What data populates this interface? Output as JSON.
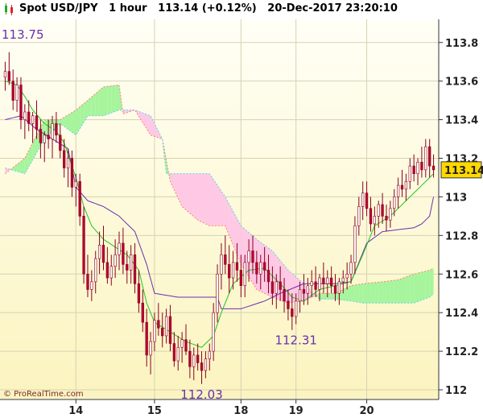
{
  "header": {
    "title": "Spot USD/JPY   1 hour   113.14 (+0.12%)   20-Dec-2017 23:20:10"
  },
  "credit": "© ProRealTime.com",
  "colors": {
    "bg_top": "#fffff6",
    "bg_bottom": "#fbf4bf",
    "candle_up": "#b8002e",
    "candle_down": "#b8002e",
    "kijun": "#6a2fb0",
    "tenkan": "#22c422",
    "cloud_bull": "#a6f59c",
    "cloud_bear": "#ffc8e4",
    "span_a": "#ff8080",
    "span_b": "#60d0f0",
    "price_badge": "#ffd800"
  },
  "chart_data": {
    "type": "candlestick",
    "title": "Spot USD/JPY   1 hour",
    "current_price": "113.14",
    "y_ticks": [
      "113.8",
      "113.6",
      "113.4",
      "113.2",
      "113",
      "112.8",
      "112.6",
      "112.4",
      "112.2",
      "112"
    ],
    "y_tick_values": [
      113.8,
      113.6,
      113.4,
      113.2,
      113.0,
      112.8,
      112.6,
      112.4,
      112.2,
      112.0
    ],
    "ylim": [
      111.95,
      113.92
    ],
    "x_ticks": [
      "14",
      "15",
      "18",
      "19",
      "20"
    ],
    "x_tick_positions": [
      18,
      38,
      60,
      74,
      92
    ],
    "x_count": 110,
    "annotations": [
      {
        "label": "113.75",
        "value": 113.75,
        "index": 0
      },
      {
        "label": "112.03",
        "value": 112.03,
        "index": 50
      },
      {
        "label": "112.31",
        "value": 112.31,
        "index": 74
      }
    ],
    "candles": [
      [
        113.62,
        113.7,
        113.55,
        113.65
      ],
      [
        113.65,
        113.75,
        113.58,
        113.6
      ],
      [
        113.6,
        113.66,
        113.45,
        113.5
      ],
      [
        113.5,
        113.62,
        113.44,
        113.58
      ],
      [
        113.58,
        113.62,
        113.35,
        113.4
      ],
      [
        113.4,
        113.48,
        113.3,
        113.44
      ],
      [
        113.44,
        113.5,
        113.34,
        113.38
      ],
      [
        113.38,
        113.44,
        113.28,
        113.42
      ],
      [
        113.42,
        113.5,
        113.3,
        113.35
      ],
      [
        113.35,
        113.4,
        113.2,
        113.28
      ],
      [
        113.28,
        113.34,
        113.18,
        113.32
      ],
      [
        113.32,
        113.4,
        113.25,
        113.3
      ],
      [
        113.3,
        113.42,
        113.2,
        113.38
      ],
      [
        113.38,
        113.44,
        113.28,
        113.32
      ],
      [
        113.32,
        113.38,
        113.2,
        113.24
      ],
      [
        113.24,
        113.3,
        113.1,
        113.15
      ],
      [
        113.15,
        113.25,
        113.05,
        113.2
      ],
      [
        113.2,
        113.24,
        113.0,
        113.05
      ],
      [
        113.05,
        113.12,
        112.95,
        113.08
      ],
      [
        113.08,
        113.12,
        112.85,
        112.9
      ],
      [
        112.9,
        112.95,
        112.55,
        112.6
      ],
      [
        112.6,
        112.7,
        112.48,
        112.52
      ],
      [
        112.52,
        112.62,
        112.46,
        112.56
      ],
      [
        112.56,
        112.72,
        112.5,
        112.68
      ],
      [
        112.68,
        112.82,
        112.6,
        112.75
      ],
      [
        112.75,
        112.85,
        112.62,
        112.66
      ],
      [
        112.66,
        112.74,
        112.55,
        112.58
      ],
      [
        112.58,
        112.7,
        112.54,
        112.64
      ],
      [
        112.64,
        112.78,
        112.58,
        112.7
      ],
      [
        112.7,
        112.82,
        112.62,
        112.76
      ],
      [
        112.76,
        112.84,
        112.6,
        112.65
      ],
      [
        112.65,
        112.72,
        112.55,
        112.62
      ],
      [
        112.62,
        112.75,
        112.55,
        112.7
      ],
      [
        112.7,
        112.76,
        112.5,
        112.55
      ],
      [
        112.55,
        112.62,
        112.4,
        112.45
      ],
      [
        112.45,
        112.52,
        112.3,
        112.35
      ],
      [
        112.35,
        112.42,
        112.12,
        112.18
      ],
      [
        112.18,
        112.3,
        112.08,
        112.25
      ],
      [
        112.25,
        112.4,
        112.2,
        112.36
      ],
      [
        112.36,
        112.45,
        112.28,
        112.32
      ],
      [
        112.32,
        112.4,
        112.22,
        112.28
      ],
      [
        112.28,
        112.42,
        112.24,
        112.38
      ],
      [
        112.38,
        112.44,
        112.2,
        112.24
      ],
      [
        112.24,
        112.3,
        112.12,
        112.15
      ],
      [
        112.15,
        112.28,
        112.1,
        112.22
      ],
      [
        112.22,
        112.3,
        112.14,
        112.26
      ],
      [
        112.26,
        112.34,
        112.18,
        112.2
      ],
      [
        112.2,
        112.26,
        112.06,
        112.12
      ],
      [
        112.12,
        112.22,
        112.05,
        112.18
      ],
      [
        112.18,
        112.24,
        112.1,
        112.14
      ],
      [
        112.14,
        112.2,
        112.03,
        112.1
      ],
      [
        112.1,
        112.2,
        112.06,
        112.16
      ],
      [
        112.16,
        112.24,
        112.1,
        112.2
      ],
      [
        112.2,
        112.45,
        112.15,
        112.4
      ],
      [
        112.4,
        112.65,
        112.35,
        112.6
      ],
      [
        112.6,
        112.76,
        112.52,
        112.7
      ],
      [
        112.7,
        112.8,
        112.6,
        112.65
      ],
      [
        112.65,
        112.75,
        112.5,
        112.58
      ],
      [
        112.58,
        112.72,
        112.52,
        112.66
      ],
      [
        112.66,
        112.76,
        112.56,
        112.62
      ],
      [
        112.62,
        112.7,
        112.48,
        112.54
      ],
      [
        112.54,
        112.7,
        112.48,
        112.66
      ],
      [
        112.66,
        112.78,
        112.56,
        112.72
      ],
      [
        112.72,
        112.8,
        112.6,
        112.66
      ],
      [
        112.66,
        112.72,
        112.55,
        112.6
      ],
      [
        112.6,
        112.7,
        112.52,
        112.66
      ],
      [
        112.66,
        112.74,
        112.56,
        112.62
      ],
      [
        112.62,
        112.7,
        112.5,
        112.56
      ],
      [
        112.56,
        112.64,
        112.44,
        112.5
      ],
      [
        112.5,
        112.6,
        112.42,
        112.56
      ],
      [
        112.56,
        112.64,
        112.46,
        112.52
      ],
      [
        112.52,
        112.58,
        112.4,
        112.46
      ],
      [
        112.46,
        112.52,
        112.36,
        112.42
      ],
      [
        112.42,
        112.5,
        112.31,
        112.38
      ],
      [
        112.38,
        112.5,
        112.34,
        112.46
      ],
      [
        112.46,
        112.56,
        112.4,
        112.52
      ],
      [
        112.52,
        112.6,
        112.44,
        112.5
      ],
      [
        112.5,
        112.58,
        112.44,
        112.54
      ],
      [
        112.54,
        112.62,
        112.48,
        112.56
      ],
      [
        112.56,
        112.64,
        112.48,
        112.52
      ],
      [
        112.52,
        112.6,
        112.46,
        112.58
      ],
      [
        112.58,
        112.66,
        112.5,
        112.55
      ],
      [
        112.55,
        112.62,
        112.48,
        112.58
      ],
      [
        112.58,
        112.64,
        112.5,
        112.54
      ],
      [
        112.54,
        112.6,
        112.46,
        112.5
      ],
      [
        112.5,
        112.58,
        112.44,
        112.56
      ],
      [
        112.56,
        112.62,
        112.5,
        112.58
      ],
      [
        112.58,
        112.66,
        112.52,
        112.6
      ],
      [
        112.6,
        112.7,
        112.55,
        112.66
      ],
      [
        112.66,
        112.9,
        112.6,
        112.85
      ],
      [
        112.85,
        113.0,
        112.8,
        112.95
      ],
      [
        112.95,
        113.08,
        112.88,
        113.02
      ],
      [
        113.02,
        113.08,
        112.9,
        112.94
      ],
      [
        112.94,
        113.0,
        112.82,
        112.86
      ],
      [
        112.86,
        112.95,
        112.8,
        112.9
      ],
      [
        112.9,
        112.98,
        112.84,
        112.96
      ],
      [
        112.96,
        113.02,
        112.86,
        112.9
      ],
      [
        112.9,
        112.96,
        112.82,
        112.88
      ],
      [
        112.88,
        112.98,
        112.84,
        112.94
      ],
      [
        112.94,
        113.04,
        112.9,
        113.0
      ],
      [
        113.0,
        113.1,
        112.94,
        113.06
      ],
      [
        113.06,
        113.14,
        113.0,
        113.04
      ],
      [
        113.04,
        113.12,
        112.98,
        113.08
      ],
      [
        113.08,
        113.2,
        113.04,
        113.16
      ],
      [
        113.16,
        113.22,
        113.08,
        113.12
      ],
      [
        113.12,
        113.2,
        113.06,
        113.18
      ],
      [
        113.18,
        113.26,
        113.1,
        113.14
      ],
      [
        113.14,
        113.3,
        113.1,
        113.26
      ],
      [
        113.26,
        113.3,
        113.1,
        113.16
      ],
      [
        113.16,
        113.22,
        113.1,
        113.14
      ]
    ],
    "tenkan": [
      [
        0,
        113.6
      ],
      [
        3,
        113.58
      ],
      [
        5,
        113.52
      ],
      [
        7,
        113.45
      ],
      [
        10,
        113.38
      ],
      [
        13,
        113.34
      ],
      [
        15,
        113.28
      ],
      [
        18,
        113.1
      ],
      [
        20,
        112.95
      ],
      [
        22,
        112.85
      ],
      [
        25,
        112.78
      ],
      [
        28,
        112.74
      ],
      [
        31,
        112.7
      ],
      [
        34,
        112.62
      ],
      [
        36,
        112.45
      ],
      [
        38,
        112.35
      ],
      [
        42,
        112.3
      ],
      [
        46,
        112.25
      ],
      [
        50,
        112.22
      ],
      [
        53,
        112.28
      ],
      [
        55,
        112.4
      ],
      [
        58,
        112.55
      ],
      [
        62,
        112.62
      ],
      [
        66,
        112.63
      ],
      [
        70,
        112.55
      ],
      [
        73,
        112.48
      ],
      [
        76,
        112.46
      ],
      [
        80,
        112.52
      ],
      [
        84,
        112.54
      ],
      [
        88,
        112.56
      ],
      [
        91,
        112.7
      ],
      [
        94,
        112.85
      ],
      [
        98,
        112.9
      ],
      [
        102,
        112.98
      ],
      [
        106,
        113.06
      ],
      [
        109,
        113.12
      ]
    ],
    "kijun": [
      [
        0,
        113.4
      ],
      [
        4,
        113.42
      ],
      [
        8,
        113.35
      ],
      [
        12,
        113.3
      ],
      [
        16,
        113.25
      ],
      [
        18,
        113.05
      ],
      [
        21,
        112.98
      ],
      [
        25,
        112.95
      ],
      [
        29,
        112.9
      ],
      [
        33,
        112.82
      ],
      [
        36,
        112.65
      ],
      [
        38,
        112.5
      ],
      [
        44,
        112.48
      ],
      [
        50,
        112.48
      ],
      [
        54,
        112.48
      ],
      [
        55,
        112.42
      ],
      [
        60,
        112.42
      ],
      [
        66,
        112.46
      ],
      [
        70,
        112.5
      ],
      [
        76,
        112.55
      ],
      [
        84,
        112.55
      ],
      [
        88,
        112.56
      ],
      [
        92,
        112.76
      ],
      [
        96,
        112.82
      ],
      [
        104,
        112.84
      ],
      [
        106,
        112.86
      ],
      [
        108,
        112.9
      ],
      [
        109,
        113.0
      ]
    ],
    "span_a": [
      [
        0,
        113.12
      ],
      [
        5,
        113.2
      ],
      [
        10,
        113.4
      ],
      [
        14,
        113.4
      ],
      [
        18,
        113.45
      ],
      [
        21,
        113.5
      ],
      [
        25,
        113.57
      ],
      [
        29,
        113.58
      ],
      [
        30,
        113.43
      ],
      [
        33,
        113.45
      ],
      [
        37,
        113.32
      ],
      [
        40,
        113.3
      ],
      [
        42,
        113.08
      ],
      [
        45,
        112.95
      ],
      [
        49,
        112.88
      ],
      [
        52,
        112.85
      ],
      [
        56,
        112.85
      ],
      [
        60,
        112.65
      ],
      [
        64,
        112.52
      ],
      [
        68,
        112.48
      ],
      [
        72,
        112.45
      ],
      [
        76,
        112.46
      ],
      [
        80,
        112.5
      ],
      [
        84,
        112.5
      ],
      [
        88,
        112.54
      ],
      [
        91,
        112.55
      ],
      [
        96,
        112.56
      ],
      [
        100,
        112.57
      ],
      [
        104,
        112.6
      ],
      [
        108,
        112.62
      ],
      [
        109,
        112.63
      ]
    ],
    "span_b": [
      [
        0,
        113.15
      ],
      [
        5,
        113.12
      ],
      [
        10,
        113.3
      ],
      [
        14,
        113.38
      ],
      [
        18,
        113.32
      ],
      [
        21,
        113.42
      ],
      [
        25,
        113.42
      ],
      [
        29,
        113.45
      ],
      [
        30,
        113.45
      ],
      [
        33,
        113.45
      ],
      [
        37,
        113.42
      ],
      [
        40,
        113.3
      ],
      [
        41,
        113.12
      ],
      [
        45,
        113.12
      ],
      [
        49,
        113.12
      ],
      [
        52,
        113.12
      ],
      [
        56,
        113.0
      ],
      [
        60,
        112.85
      ],
      [
        64,
        112.78
      ],
      [
        68,
        112.72
      ],
      [
        72,
        112.62
      ],
      [
        76,
        112.55
      ],
      [
        80,
        112.47
      ],
      [
        84,
        112.47
      ],
      [
        88,
        112.46
      ],
      [
        91,
        112.45
      ],
      [
        96,
        112.45
      ],
      [
        100,
        112.45
      ],
      [
        104,
        112.45
      ],
      [
        108,
        112.48
      ],
      [
        109,
        112.5
      ]
    ]
  }
}
